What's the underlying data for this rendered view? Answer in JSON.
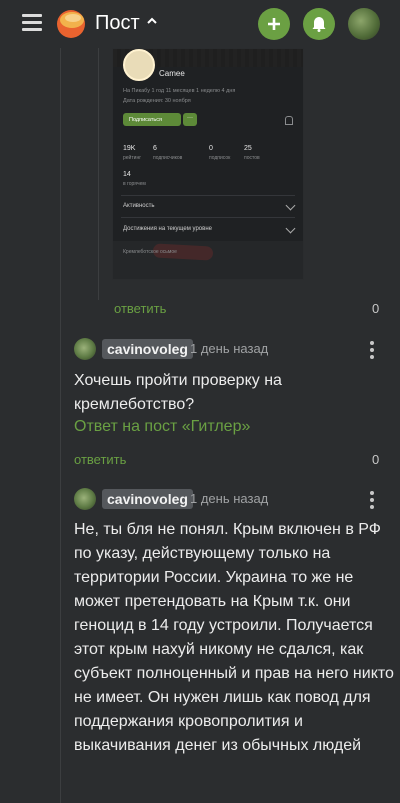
{
  "topbar": {
    "title": "Пост"
  },
  "embed": {
    "name": "Camee",
    "meta1": "На Пикабу 1 год 11 месяцев 1 неделю 4 дня",
    "meta2": "Дата рождения: 30 ноября",
    "subscribe": "Подписаться",
    "dots": "···",
    "stats": [
      {
        "value": "19K",
        "label": "рейтинг"
      },
      {
        "value": "6",
        "label": "подписчиков"
      },
      {
        "value": "0",
        "label": "подписок"
      },
      {
        "value": "25",
        "label": "постов"
      }
    ],
    "hot": {
      "value": "14",
      "label": "в горячем"
    },
    "rows": [
      "Активность",
      "Достижения на текущем уровне"
    ],
    "footer": "Кремлеботское осьмое"
  },
  "comments": [
    {
      "reply_label": "ответить",
      "count": "0"
    },
    {
      "nick": "cavinovoleg",
      "time": "1 день назад",
      "text": "Хочешь пройти проверку на кремлеботство?",
      "answer_link": "Ответ на пост «Гитлер»",
      "reply_label": "ответить",
      "count": "0"
    },
    {
      "nick": "cavinovoleg",
      "time": "1 день назад",
      "text": "Не, ты бля не понял. Крым включен в РФ по указу, действующему только на территории России. Украина то же не может претендовать на Крым т.к. они геноцид в 14 году устроили. Получается этот крым нахуй никому не сдался, как субъект полноценный и прав на него никто не имеет. Он нужен лишь как повод для поддержания кровопролития и выкачивания денег из обычных людей"
    }
  ],
  "colors": {
    "accent": "#6aa043",
    "background": "#2b2d2f"
  },
  "icons": [
    "menu-icon",
    "logo-icon",
    "chevron-up-icon",
    "plus-icon",
    "bell-icon",
    "avatar",
    "kebab-icon"
  ]
}
